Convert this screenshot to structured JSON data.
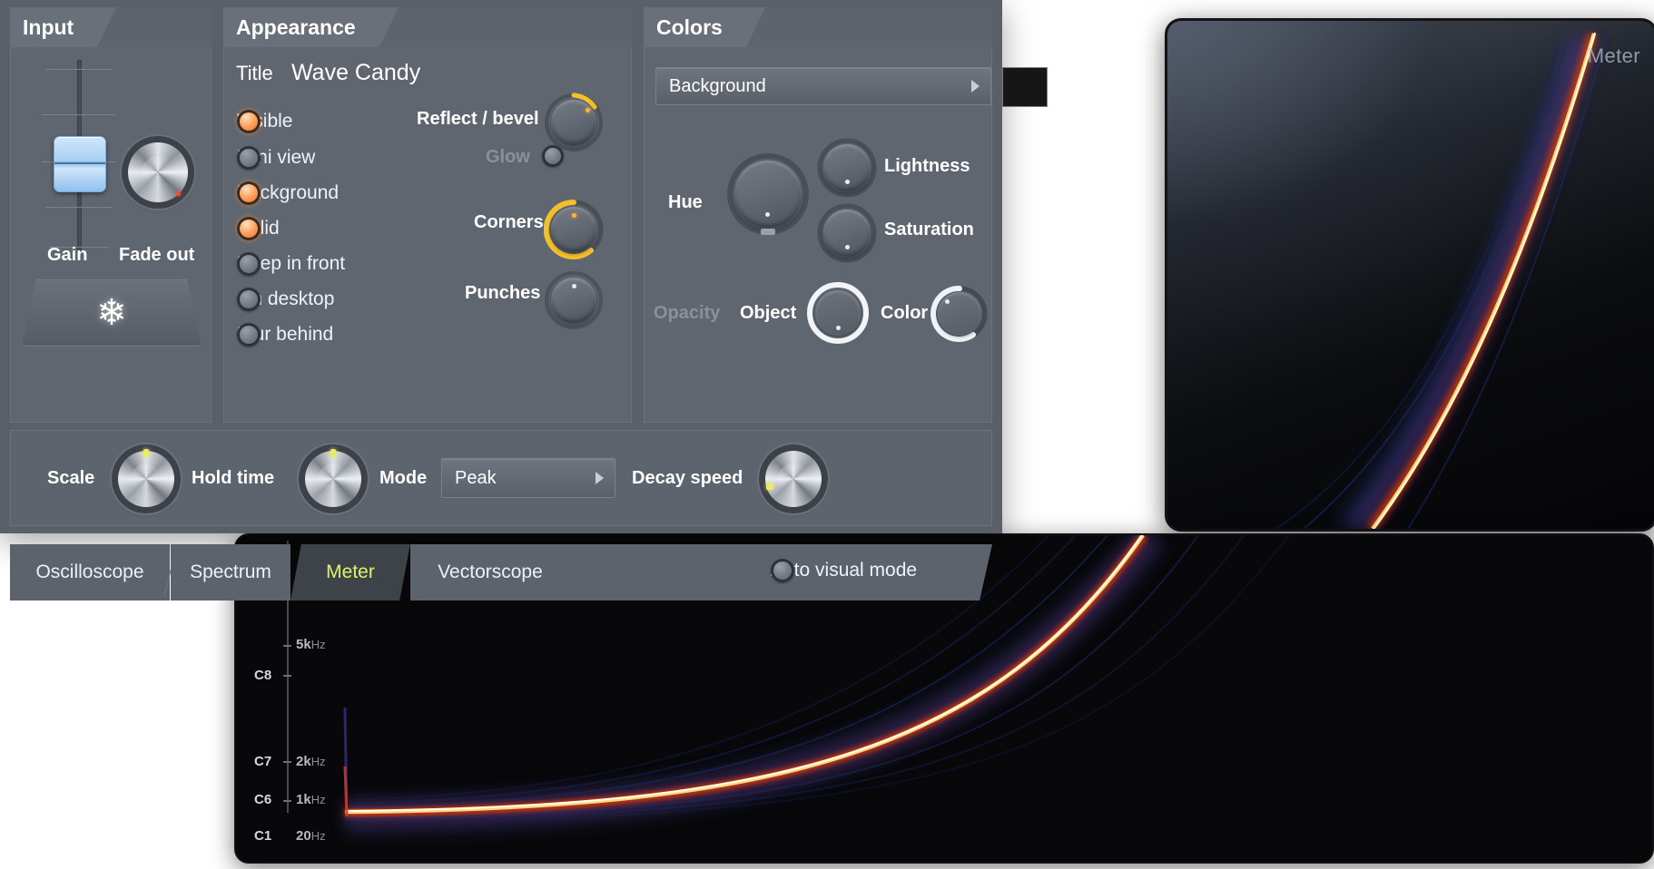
{
  "visualizers": {
    "top_window_title": "Meter",
    "bottom_window": {
      "note_labels": [
        "C8",
        "C7",
        "C6",
        "C1"
      ],
      "freq_labels": [
        {
          "value": "5k",
          "unit": "Hz"
        },
        {
          "value": "2k",
          "unit": "Hz"
        },
        {
          "value": "1k",
          "unit": "Hz"
        },
        {
          "value": "20",
          "unit": "Hz"
        }
      ]
    }
  },
  "panels": {
    "input": {
      "header": "Input",
      "gain_label": "Gain",
      "fade_out_label": "Fade out",
      "freeze_icon": "snowflake-icon",
      "freeze_glyph": "❄"
    },
    "appearance": {
      "header": "Appearance",
      "title_label": "Title",
      "title_value": "Wave Candy",
      "options": [
        {
          "label": "Visible",
          "state": "on"
        },
        {
          "label": "Mini view",
          "state": "off"
        },
        {
          "label": "Background",
          "state": "on"
        },
        {
          "label": "Solid",
          "state": "on"
        },
        {
          "label": "Keep in front",
          "state": "off"
        },
        {
          "label": "On desktop",
          "state": "off"
        },
        {
          "label": "Blur behind",
          "state": "off"
        }
      ],
      "knobs": [
        {
          "label": "Reflect / bevel",
          "arc": "small"
        },
        {
          "label": "Corners",
          "arc": "large"
        },
        {
          "label": "Punches",
          "arc": "none"
        }
      ],
      "glow_label": "Glow",
      "glow_state": "off"
    },
    "colors": {
      "header": "Colors",
      "selector_value": "Background",
      "swatch_color": "#161616",
      "hue_label": "Hue",
      "lightness_label": "Lightness",
      "saturation_label": "Saturation",
      "opacity_label": "Opacity",
      "object_label": "Object",
      "color_label": "Color"
    }
  },
  "control_bar": {
    "scale_label": "Scale",
    "hold_time_label": "Hold time",
    "mode_label": "Mode",
    "mode_value": "Peak",
    "decay_speed_label": "Decay speed"
  },
  "tabs": {
    "items": [
      {
        "label": "Oscilloscope",
        "active": false
      },
      {
        "label": "Spectrum",
        "active": false
      },
      {
        "label": "Meter",
        "active": true
      },
      {
        "label": "Vectorscope",
        "active": false
      }
    ],
    "auto_visual_mode_label": "Auto visual mode",
    "auto_visual_mode_state": "off"
  },
  "colors": {
    "panel_bg": "#5f646c",
    "accent_active_tab": "#dff06a",
    "radio_on": "#ff9b3c",
    "knob_arc": "#f4c02a"
  }
}
